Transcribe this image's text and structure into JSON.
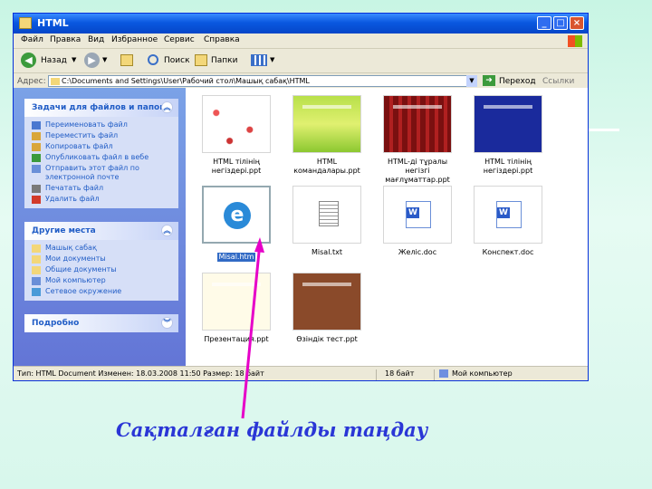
{
  "window": {
    "title": "HTML",
    "menu": [
      "Файл",
      "Правка",
      "Вид",
      "Избранное",
      "Сервис",
      "Справка"
    ],
    "toolbar": {
      "back": "Назад",
      "search": "Поиск",
      "folders": "Папки"
    },
    "address": {
      "label": "Адрес:",
      "path": "C:\\Documents and Settings\\User\\Рабочий стол\\Машық сабақ\\HTML",
      "go": "Переход",
      "links": "Ссылки"
    }
  },
  "sidebar": {
    "tasks": {
      "title": "Задачи для файлов и папок",
      "items": [
        {
          "label": "Переименовать файл",
          "icon": "rename-icon"
        },
        {
          "label": "Переместить файл",
          "icon": "move-icon"
        },
        {
          "label": "Копировать файл",
          "icon": "copy-icon"
        },
        {
          "label": "Опубликовать файл в вебе",
          "icon": "web-publish-icon"
        },
        {
          "label": "Отправить этот файл по электронной почте",
          "icon": "email-icon"
        },
        {
          "label": "Печатать файл",
          "icon": "print-icon"
        },
        {
          "label": "Удалить файл",
          "icon": "delete-icon"
        }
      ]
    },
    "places": {
      "title": "Другие места",
      "items": [
        {
          "label": "Машық сабақ",
          "icon": "folder-icon"
        },
        {
          "label": "Мои документы",
          "icon": "folder-icon"
        },
        {
          "label": "Общие документы",
          "icon": "folder-icon"
        },
        {
          "label": "Мой компьютер",
          "icon": "computer-icon"
        },
        {
          "label": "Сетевое окружение",
          "icon": "network-icon"
        }
      ]
    },
    "details": {
      "title": "Подробно"
    }
  },
  "files": [
    {
      "name": "HTML тілінің негіздері.ppt",
      "kind": "ppt"
    },
    {
      "name": "HTML командалары.ppt",
      "kind": "ppt"
    },
    {
      "name": "HTML-ді тұралы негізгі мағлұматтар.ppt",
      "kind": "ppt"
    },
    {
      "name": "HTML тілінің негіздері.ppt",
      "kind": "ppt"
    },
    {
      "name": "Misal.htm",
      "kind": "htm"
    },
    {
      "name": "Misal.txt",
      "kind": "txt"
    },
    {
      "name": "Желіс.doc",
      "kind": "doc"
    },
    {
      "name": "Конспект.doc",
      "kind": "doc"
    },
    {
      "name": "Презентация.ppt",
      "kind": "ppt"
    },
    {
      "name": "Өзіндік тест.ppt",
      "kind": "ppt"
    }
  ],
  "status": {
    "info": "Тип: HTML Document Изменен: 18.03.2008 11:50 Размер: 18 байт",
    "size": "18 байт",
    "location": "Мой компьютер"
  },
  "caption": "Сақталған файлды таңдау",
  "colors": {
    "title_bar": "#0a58e0",
    "caption": "#2a36d6",
    "arrow": "#e600c8",
    "sidebar": "#6f8fe0",
    "selection": "#316ac5"
  }
}
